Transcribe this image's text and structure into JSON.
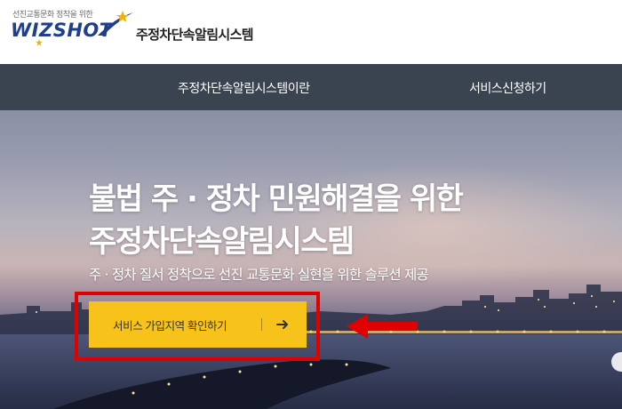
{
  "header": {
    "tagline": "선진교통문화 정착을 위한",
    "logo_text": "WIZSHOT",
    "system_name": "주정차단속알림시스템"
  },
  "nav": {
    "items": [
      {
        "label": "주정차단속알림시스템이란"
      },
      {
        "label": "서비스신청하기"
      }
    ]
  },
  "hero": {
    "title_line1": "불법 주 · 정차 민원해결을 위한",
    "title_line2": "주정차단속알림시스템",
    "subtitle": "주 · 정차 질서 정착으로 선진 교통문화 실현을 위한 솔루션 제공",
    "cta_label": "서비스 가입지역 확인하기"
  },
  "icons": {
    "cta_arrow": "arrow-right-icon",
    "annotation_arrow": "arrow-left-icon",
    "logo_swoosh": "shooting-star-icon"
  },
  "colors": {
    "brand_blue": "#1f3f8c",
    "nav_bg": "#3a4350",
    "cta_bg": "#f7c31b",
    "highlight_red": "#e10000"
  }
}
